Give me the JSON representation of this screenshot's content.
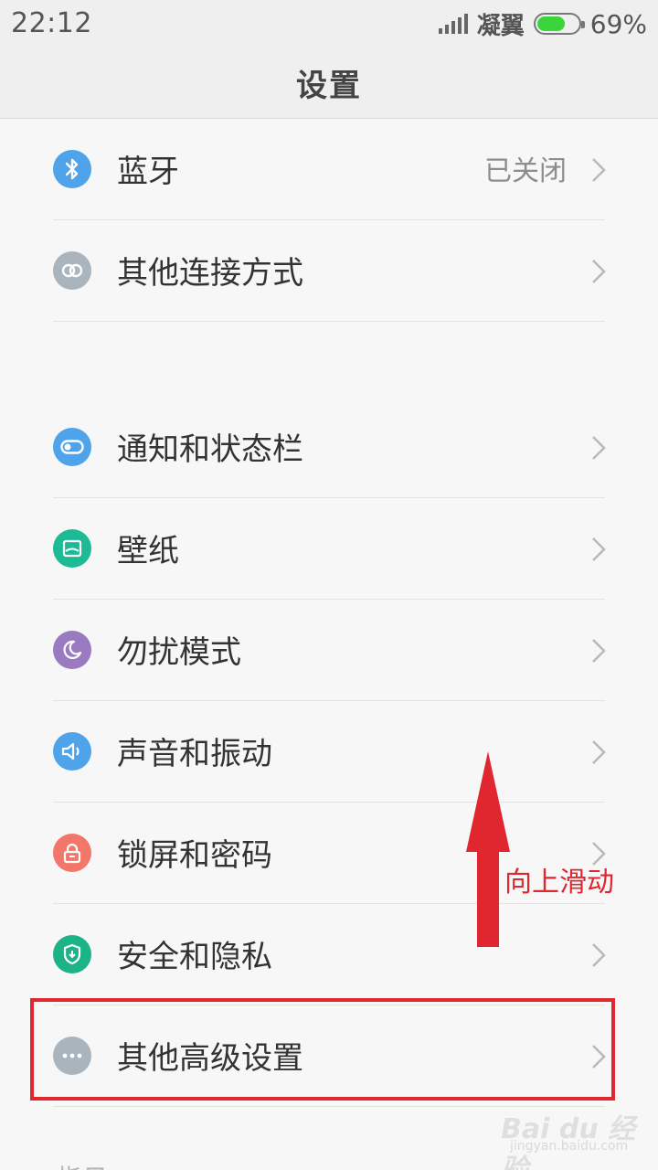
{
  "status_bar": {
    "time": "22:12",
    "carrier": "凝翼",
    "battery_percent": "69%",
    "battery_level": 0.69
  },
  "header": {
    "title": "设置"
  },
  "items": [
    {
      "label": "蓝牙",
      "value": "已关闭",
      "icon": "bluetooth-icon",
      "color": "#4fa3ea"
    },
    {
      "label": "其他连接方式",
      "icon": "link-icon",
      "color": "#a9b4bd"
    },
    {
      "label": "通知和状态栏",
      "icon": "toggle-icon",
      "color": "#4fa3ea"
    },
    {
      "label": "壁纸",
      "icon": "picture-icon",
      "color": "#1dba96"
    },
    {
      "label": "勿扰模式",
      "icon": "moon-icon",
      "color": "#9a7bc2"
    },
    {
      "label": "声音和振动",
      "icon": "speaker-icon",
      "color": "#4fa3ea"
    },
    {
      "label": "锁屏和密码",
      "icon": "lock-icon",
      "color": "#f2776a"
    },
    {
      "label": "安全和隐私",
      "icon": "shield-icon",
      "color": "#1db389"
    },
    {
      "label": "其他高级设置",
      "icon": "more-icon",
      "color": "#a9b4bd"
    }
  ],
  "annotation": {
    "scroll_hint": "向上滑动",
    "color": "#e0262f"
  },
  "partial_section_label": "指日",
  "watermark": {
    "logo": "Bai du 经验",
    "url": "jingyan.baidu.com"
  }
}
